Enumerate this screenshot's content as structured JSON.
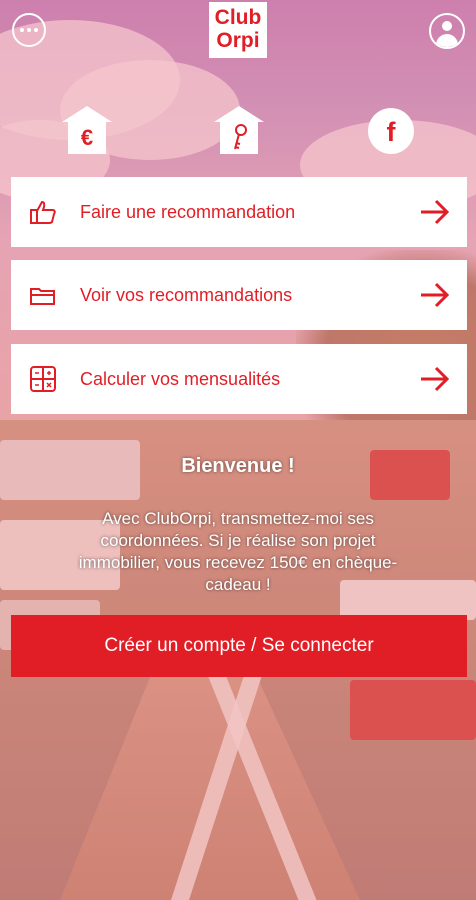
{
  "header": {
    "logo_line1": "Club",
    "logo_line2": "Orpi",
    "menu_icon": "more-dots-icon",
    "profile_icon": "user-profile-icon"
  },
  "quick_links": [
    {
      "icon": "euro-house-icon",
      "glyph": "€"
    },
    {
      "icon": "key-house-icon",
      "glyph": ""
    },
    {
      "icon": "facebook-icon",
      "glyph": "f"
    }
  ],
  "actions": [
    {
      "label": "Faire une recommandation",
      "icon": "thumbs-up-icon"
    },
    {
      "label": "Voir vos recommandations",
      "icon": "folder-icon"
    },
    {
      "label": "Calculer vos mensualités",
      "icon": "calculator-icon"
    }
  ],
  "welcome": {
    "title": "Bienvenue !",
    "text": "Avec ClubOrpi, transmettez-moi ses coordonnées. Si je réalise son projet immobilier, vous recevez 150€ en chèque-cadeau !"
  },
  "cta": {
    "label": "Créer un compte / Se connecter"
  },
  "colors": {
    "brand_red": "#e11e26",
    "white": "#ffffff"
  }
}
